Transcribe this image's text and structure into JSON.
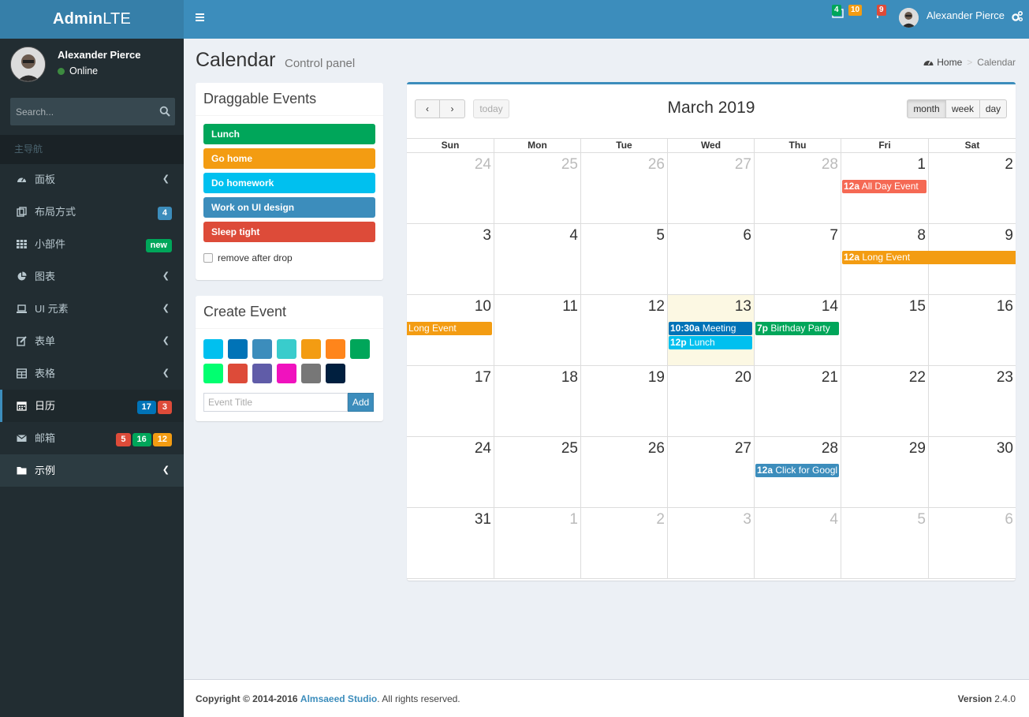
{
  "logo": {
    "bold": "Admin",
    "light": "LTE"
  },
  "user": {
    "name": "Alexander Pierce",
    "status": "Online"
  },
  "search": {
    "placeholder": "Search..."
  },
  "sidebar": {
    "header": "主导航",
    "items": [
      {
        "label": "面板"
      },
      {
        "label": "布局方式",
        "badges": [
          "4"
        ]
      },
      {
        "label": "小部件",
        "badges": [
          "new"
        ]
      },
      {
        "label": "图表"
      },
      {
        "label": "UI 元素"
      },
      {
        "label": "表单"
      },
      {
        "label": "表格"
      },
      {
        "label": "日历",
        "badges": [
          "17",
          "3"
        ]
      },
      {
        "label": "邮箱",
        "badges": [
          "5",
          "16",
          "12"
        ]
      },
      {
        "label": "示例"
      }
    ]
  },
  "topbar": {
    "notifications": {
      "messages": "4",
      "alerts": "10",
      "tasks": "9"
    },
    "user_name": "Alexander Pierce"
  },
  "page": {
    "title": "Calendar",
    "subtitle": "Control panel",
    "breadcrumb": {
      "home": "Home",
      "current": "Calendar"
    }
  },
  "draggable": {
    "title": "Draggable Events",
    "events": [
      "Lunch",
      "Go home",
      "Do homework",
      "Work on UI design",
      "Sleep tight"
    ],
    "remove_label": "remove after drop"
  },
  "create_event": {
    "title": "Create Event",
    "colors": [
      "#00c0ef",
      "#0073b7",
      "#3c8dbc",
      "#39cccc",
      "#f39c12",
      "#ff851b",
      "#00a65a",
      "#01ff70",
      "#dd4b39",
      "#605ca8",
      "#f012be",
      "#777777",
      "#001f3f"
    ],
    "input_placeholder": "Event Title",
    "add_label": "Add"
  },
  "calendar": {
    "title": "March 2019",
    "buttons": {
      "today": "today",
      "month": "month",
      "week": "week",
      "day": "day"
    },
    "weekdays": [
      "Sun",
      "Mon",
      "Tue",
      "Wed",
      "Thu",
      "Fri",
      "Sat"
    ],
    "weeks": [
      [
        "24",
        "25",
        "26",
        "27",
        "28",
        "1",
        "2"
      ],
      [
        "3",
        "4",
        "5",
        "6",
        "7",
        "8",
        "9"
      ],
      [
        "10",
        "11",
        "12",
        "13",
        "14",
        "15",
        "16"
      ],
      [
        "17",
        "18",
        "19",
        "20",
        "21",
        "22",
        "23"
      ],
      [
        "24",
        "25",
        "26",
        "27",
        "28",
        "29",
        "30"
      ],
      [
        "31",
        "1",
        "2",
        "3",
        "4",
        "5",
        "6"
      ]
    ],
    "events": {
      "all_day": {
        "time": "12a",
        "title": "All Day Event"
      },
      "long_event": {
        "time": "12a",
        "title": "Long Event"
      },
      "long_event_cont": {
        "title": "Long Event"
      },
      "meeting": {
        "time": "10:30a",
        "title": "Meeting"
      },
      "lunch": {
        "time": "12p",
        "title": "Lunch"
      },
      "birthday": {
        "time": "7p",
        "title": "Birthday Party"
      },
      "google": {
        "time": "12a",
        "title": "Click for Googl"
      }
    }
  },
  "footer": {
    "copyright": "Copyright © 2014-2016",
    "studio": "Almsaeed Studio",
    "rights": ". All rights reserved.",
    "version_label": "Version",
    "version": "2.4.0"
  }
}
